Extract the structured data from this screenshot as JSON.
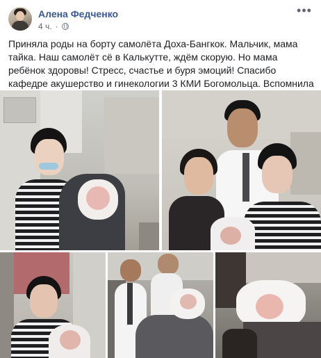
{
  "post": {
    "author": "Алена Федченко",
    "time": "4 ч.",
    "audience_icon": "globe-icon",
    "more_icon": "more-options-icon",
    "text": "Приняла роды на борту самолёта Доха-Бангкок. Мальчик, мама тайка. Наш самолёт сё в Калькутте, ждём скорую. Но мама ребёнок здоровы! Стресс, счастье и буря эмоций! Спасибо кафедре акушерство и гинекологии 3 КМИ Богомольца. Вспомнила все в одну минуту!"
  },
  "colors": {
    "author_link": "#385898",
    "text": "#1c1e21",
    "meta": "#616770"
  }
}
